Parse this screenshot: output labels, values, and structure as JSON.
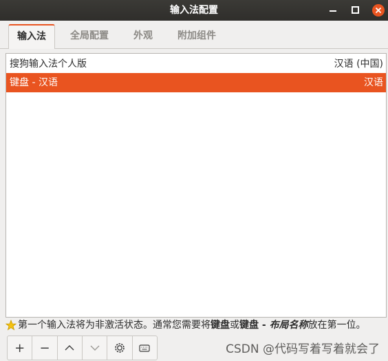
{
  "window": {
    "title": "输入法配置"
  },
  "tabs": [
    {
      "label": "输入法",
      "active": true
    },
    {
      "label": "全局配置",
      "active": false
    },
    {
      "label": "外观",
      "active": false
    },
    {
      "label": "附加组件",
      "active": false
    }
  ],
  "input_methods": [
    {
      "name": "搜狗输入法个人版",
      "language": "汉语 (中国)",
      "selected": false
    },
    {
      "name": "键盘 - 汉语",
      "language": "汉语",
      "selected": true
    }
  ],
  "hint": {
    "icon": "star-icon",
    "part1": "第一个输入法将为非激活状态。通常您需要将",
    "bold1": "键盘",
    "part2": "或",
    "bold2": "键盘 - ",
    "italic": "布局名称",
    "part3": "放在第一位。"
  },
  "toolbar": {
    "add_label": "+",
    "remove_label": "−"
  },
  "watermark": "CSDN @代码写着写着就会了",
  "colors": {
    "accent": "#e95420",
    "titlebar": "#35342f"
  }
}
